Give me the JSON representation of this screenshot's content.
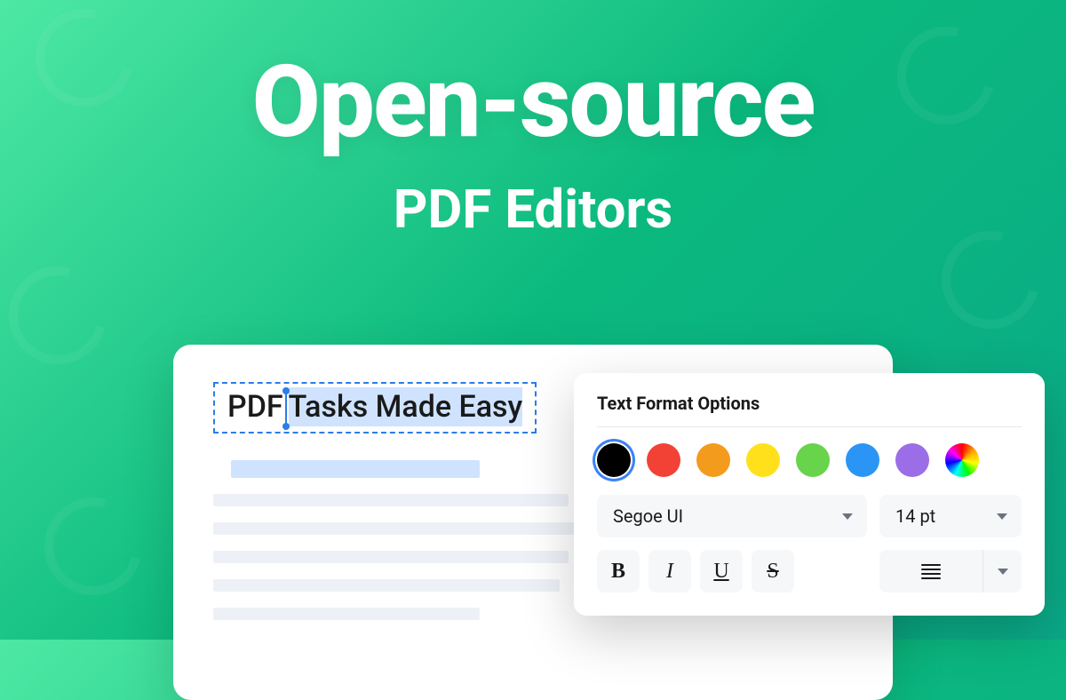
{
  "hero": {
    "title": "Open-source",
    "subtitle": "PDF Editors"
  },
  "document": {
    "text_prefix": "PDF",
    "text_selected": "Tasks Made Easy"
  },
  "format_panel": {
    "title": "Text Format Options",
    "colors": [
      {
        "name": "black",
        "hex": "#000000",
        "selected": true
      },
      {
        "name": "red",
        "hex": "#f24236",
        "selected": false
      },
      {
        "name": "orange",
        "hex": "#f39b1c",
        "selected": false
      },
      {
        "name": "yellow",
        "hex": "#ffe01b",
        "selected": false
      },
      {
        "name": "green",
        "hex": "#67d44b",
        "selected": false
      },
      {
        "name": "blue",
        "hex": "#2b95f5",
        "selected": false
      },
      {
        "name": "purple",
        "hex": "#9b6ee8",
        "selected": false
      },
      {
        "name": "rainbow",
        "hex": "rainbow",
        "selected": false
      }
    ],
    "font_family": "Segoe UI",
    "font_size": "14 pt",
    "style_buttons": {
      "bold": "B",
      "italic": "I",
      "underline": "U",
      "strike": "S"
    }
  }
}
